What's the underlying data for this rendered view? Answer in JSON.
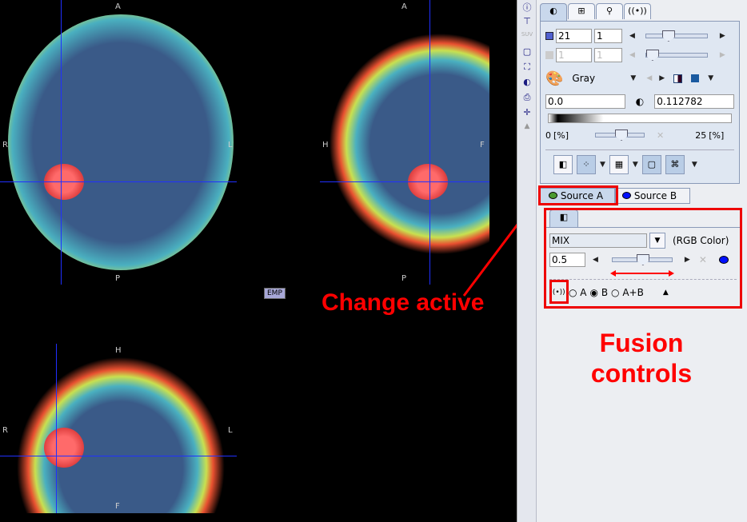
{
  "views": {
    "axial": {
      "top": "A",
      "bottom": "P",
      "left": "R",
      "right": "L"
    },
    "sagittal": {
      "top": "A",
      "bottom": "P",
      "left": "H",
      "right": "F"
    },
    "coronal": {
      "top": "H",
      "bottom": "F",
      "left": "R",
      "right": "L"
    },
    "emp_label": "EMP"
  },
  "toolbar_icons": [
    "info-icon",
    "network-icon",
    "suv-icon",
    "roi-icon",
    "zoom-fit-icon",
    "contrast-icon",
    "print-icon",
    "crosshair-icon",
    "collapse-icon"
  ],
  "suv_label": "SUV",
  "panel": {
    "tabs": [
      "contrast-icon",
      "layout-icon",
      "tool-icon",
      "fusion-icon"
    ],
    "slice": "21",
    "frame": "1",
    "slice2": "1",
    "frame2": "1",
    "slider_slice": 0.4,
    "slider_frame": 0.0,
    "colormap": "Gray",
    "min": "0.0",
    "max": "0.112782",
    "pct_low": "0",
    "pct_high": "25",
    "pct_unit": "[%]",
    "slider_pct": 0.5
  },
  "sources": {
    "a": "Source A",
    "b": "Source B",
    "a_color": "#4a9a30",
    "b_color": "#0010ff"
  },
  "fusion": {
    "mode": "MIX",
    "mode_type": "(RGB Color)",
    "ratio": "0.5",
    "slider_ratio": 0.5,
    "radio": [
      "A",
      "B",
      "A+B"
    ],
    "selected": "B"
  },
  "annotations": {
    "change": "Change active",
    "fusion": "Fusion\ncontrols"
  }
}
